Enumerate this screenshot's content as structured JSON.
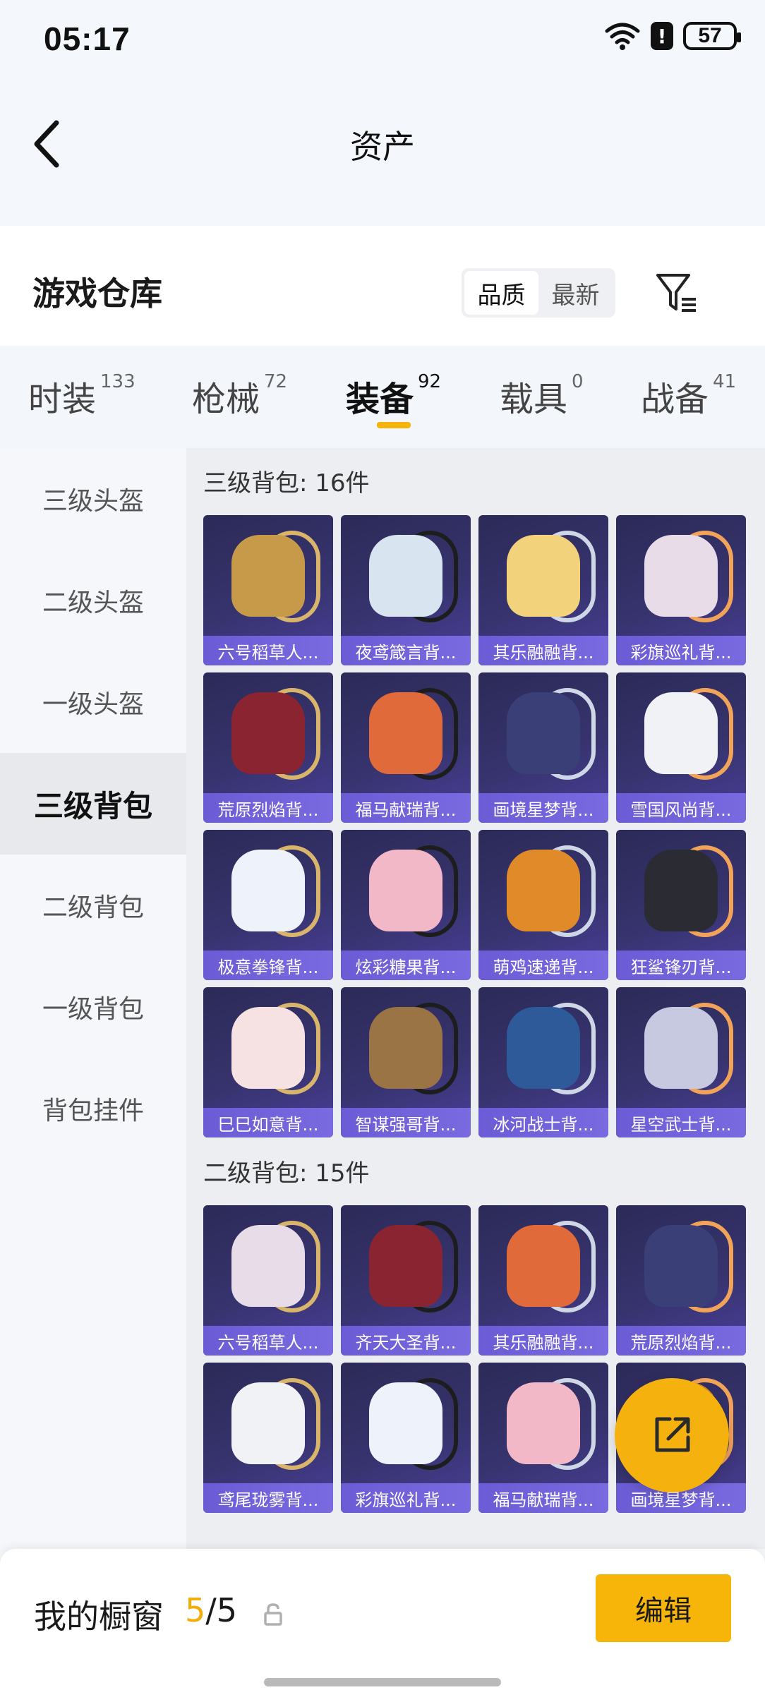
{
  "status_bar": {
    "time": "05:17",
    "battery": "57",
    "alert": "!"
  },
  "header": {
    "title": "资产"
  },
  "warehouse": {
    "title": "游戏仓库",
    "sort_options": [
      "品质",
      "最新"
    ],
    "active_sort": "品质"
  },
  "category_tabs": [
    {
      "label": "时装",
      "count": "133"
    },
    {
      "label": "枪械",
      "count": "72"
    },
    {
      "label": "装备",
      "count": "92",
      "active": true
    },
    {
      "label": "载具",
      "count": "0"
    },
    {
      "label": "战备",
      "count": "41"
    }
  ],
  "sidebar": {
    "items": [
      "三级头盔",
      "二级头盔",
      "一级头盔",
      "三级背包",
      "二级背包",
      "一级背包",
      "背包挂件"
    ],
    "active": "三级背包"
  },
  "sections": [
    {
      "title": "三级背包: 16件",
      "items": [
        "六号稻草人...",
        "夜鸢箴言背...",
        "其乐融融背...",
        "彩旗巡礼背...",
        "荒原烈焰背...",
        "福马献瑞背...",
        "画境星梦背...",
        "雪国风尚背...",
        "极意拳锋背...",
        "炫彩糖果背...",
        "萌鸡速递背...",
        "狂鲨锋刃背...",
        "巳巳如意背...",
        "智谋强哥背...",
        "冰河战士背...",
        "星空武士背..."
      ]
    },
    {
      "title": "二级背包: 15件",
      "items": [
        "六号稻草人...",
        "齐天大圣背...",
        "其乐融融背...",
        "荒原烈焰背...",
        "鸢尾珑雾背...",
        "彩旗巡礼背...",
        "福马献瑞背...",
        "画境星梦背..."
      ]
    }
  ],
  "bag_colors": [
    "#c79a4a",
    "#d8e4ef",
    "#f2d27a",
    "#e8dce8",
    "#8a2430",
    "#e06a3a",
    "#3b3f78",
    "#f1f2f6",
    "#eef2fb",
    "#f3b8c8",
    "#e08a2a",
    "#2b2b33",
    "#f6e1e3",
    "#9a7444",
    "#2e5a9a",
    "#c7c9e0"
  ],
  "showcase": {
    "label": "我的橱窗",
    "current": "5",
    "total": "/5"
  },
  "edit_button": "编辑",
  "icons": [
    "back-arrow-icon",
    "filter-icon",
    "share-icon",
    "lock-icon",
    "wifi-icon",
    "battery-icon"
  ]
}
